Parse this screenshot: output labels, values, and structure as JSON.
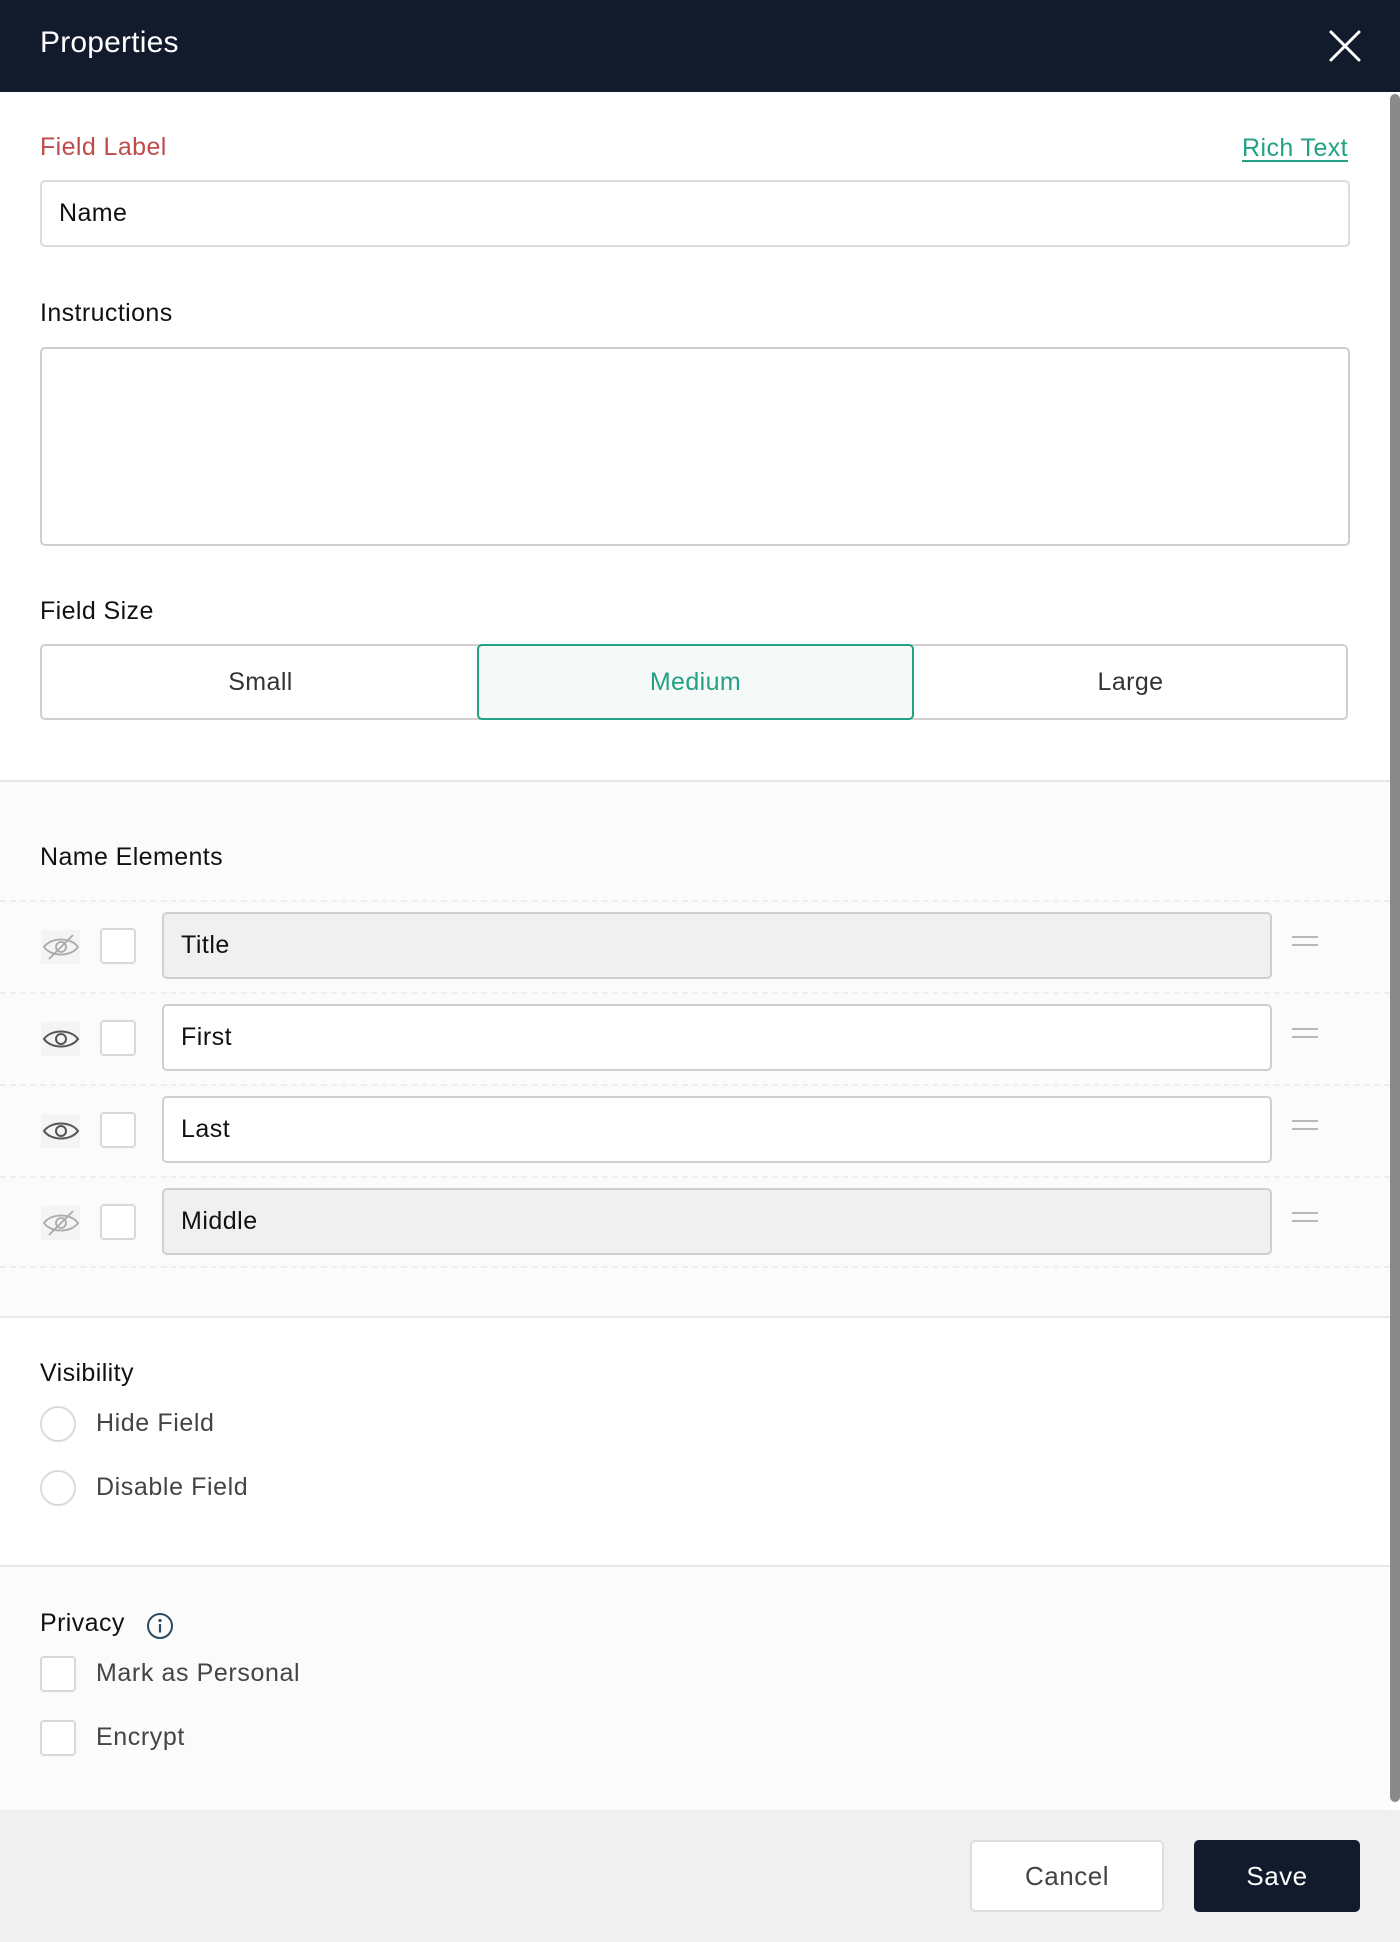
{
  "header": {
    "title": "Properties",
    "close_icon": "close-icon"
  },
  "field_label": {
    "label": "Field Label",
    "rich_text_link": "Rich Text",
    "value": "Name"
  },
  "instructions": {
    "label": "Instructions",
    "value": ""
  },
  "field_size": {
    "label": "Field Size",
    "options": [
      "Small",
      "Medium",
      "Large"
    ],
    "selected": "Medium"
  },
  "name_elements": {
    "label": "Name Elements",
    "items": [
      {
        "label": "Title",
        "visible": false,
        "checked": false,
        "eye_icon": "eye-slash-icon"
      },
      {
        "label": "First",
        "visible": true,
        "checked": false,
        "eye_icon": "eye-icon"
      },
      {
        "label": "Last",
        "visible": true,
        "checked": false,
        "eye_icon": "eye-icon"
      },
      {
        "label": "Middle",
        "visible": false,
        "checked": false,
        "eye_icon": "eye-slash-icon"
      }
    ]
  },
  "visibility": {
    "label": "Visibility",
    "options": [
      {
        "label": "Hide Field",
        "selected": false
      },
      {
        "label": "Disable Field",
        "selected": false
      }
    ]
  },
  "privacy": {
    "label": "Privacy",
    "info_icon": "info-icon",
    "options": [
      {
        "label": "Mark as Personal",
        "checked": false
      },
      {
        "label": "Encrypt",
        "checked": false
      }
    ]
  },
  "footer": {
    "cancel_label": "Cancel",
    "save_label": "Save"
  },
  "colors": {
    "header_bg": "#111b2c",
    "accent": "#22a184",
    "required_label": "#bf4b4b",
    "save_bg": "#111b2c"
  }
}
